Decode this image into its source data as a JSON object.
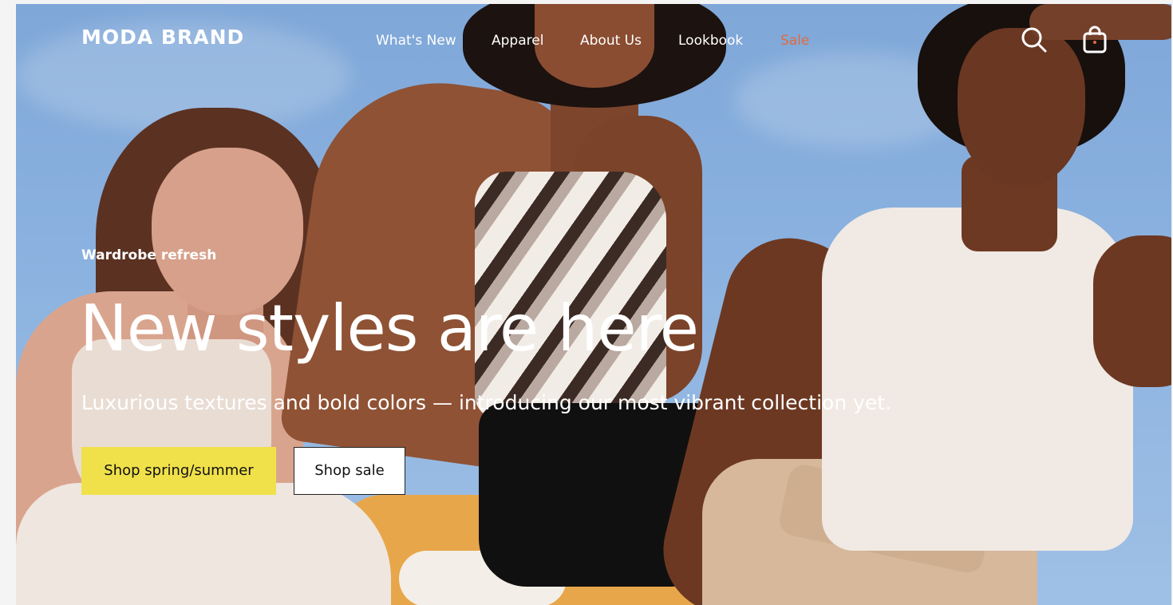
{
  "header": {
    "brand": "MODA BRAND",
    "nav": [
      {
        "label": "What's New"
      },
      {
        "label": "Apparel"
      },
      {
        "label": "About Us"
      },
      {
        "label": "Lookbook"
      },
      {
        "label": "Sale"
      }
    ],
    "icons": {
      "search": "search-icon",
      "bag": "shopping-bag-icon"
    }
  },
  "hero": {
    "eyebrow": "Wardrobe refresh",
    "headline": "New styles are here",
    "subtitle": "Luxurious textures and bold colors — introducing our most vibrant collection yet.",
    "primary_cta": "Shop spring/summer",
    "secondary_cta": "Shop sale"
  },
  "colors": {
    "sale": "#e06a3f",
    "primary_button": "#f0e14a",
    "text_on_image": "#ffffff"
  }
}
